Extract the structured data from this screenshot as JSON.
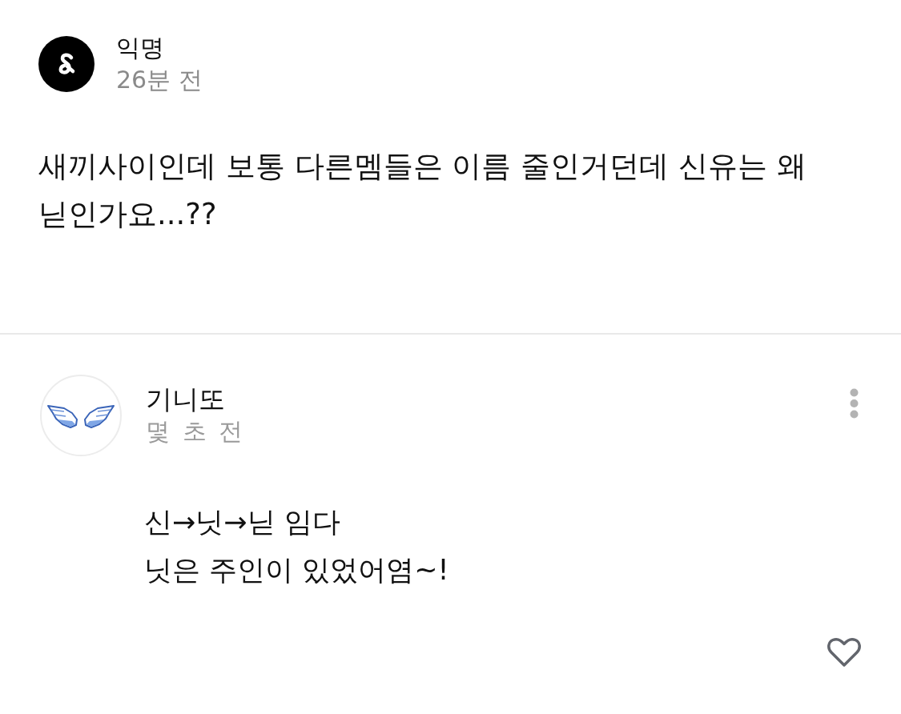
{
  "post": {
    "author": "익명",
    "time": "26분 전",
    "body": "새끼사이인데 보통 다른멤들은 이름 줄인거던데 신유는 왜 닏인가요...??"
  },
  "comments": [
    {
      "author": "기니또",
      "time": "몇 초 전",
      "body": "신→닛→닏 임다\n닛은 주인이 있었어염~!",
      "liked": false
    }
  ]
}
